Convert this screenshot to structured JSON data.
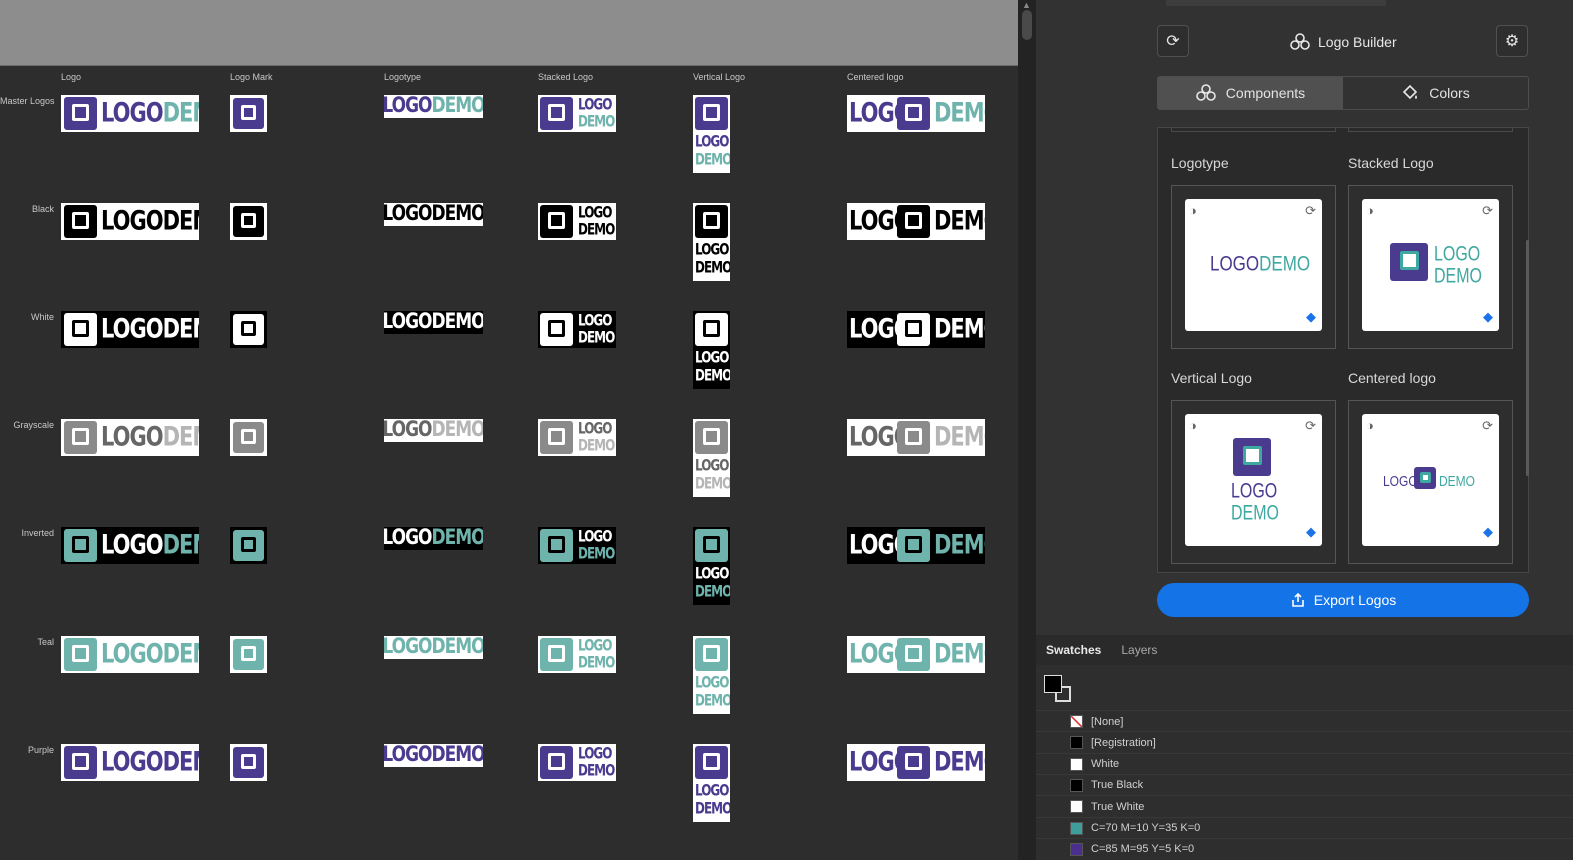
{
  "canvas": {
    "columns": [
      "Logo",
      "Logo Mark",
      "Logotype",
      "Stacked Logo",
      "Vertical Logo",
      "Centered logo"
    ],
    "rows": [
      {
        "label": "Master Logos",
        "bg": "#ffffff",
        "mark": "#4b3b8f",
        "markInner": "#ffffff",
        "word1": "#4b3b8f",
        "word2": "#6fb3ad"
      },
      {
        "label": "Black",
        "bg": "#ffffff",
        "mark": "#000000",
        "markInner": "#ffffff",
        "word1": "#000000",
        "word2": "#000000"
      },
      {
        "label": "White",
        "bg": "#000000",
        "mark": "#ffffff",
        "markInner": "#000000",
        "word1": "#ffffff",
        "word2": "#ffffff"
      },
      {
        "label": "Grayscale",
        "bg": "#ffffff",
        "mark": "#8a8a8a",
        "markInner": "#ffffff",
        "word1": "#666666",
        "word2": "#b5b5b5"
      },
      {
        "label": "Inverted",
        "bg": "#000000",
        "mark": "#6fb3ad",
        "markInner": "#000000",
        "word1": "#ffffff",
        "word2": "#6fb3ad"
      },
      {
        "label": "Teal",
        "bg": "#ffffff",
        "mark": "#6fb3ad",
        "markInner": "#ffffff",
        "word1": "#6fb3ad",
        "word2": "#6fb3ad"
      },
      {
        "label": "Purple",
        "bg": "#ffffff",
        "mark": "#4b3b8f",
        "markInner": "#ffffff",
        "word1": "#4b3b8f",
        "word2": "#4b3b8f"
      }
    ],
    "word1": "LOGO",
    "word2": "DEMO"
  },
  "panel": {
    "title": "Logo Builder",
    "tabs": [
      {
        "label": "Components",
        "icon": "components-icon",
        "active": true
      },
      {
        "label": "Colors",
        "icon": "paint-bucket-icon",
        "active": false
      }
    ],
    "cards": [
      {
        "label": "Logotype",
        "kind": "logotype"
      },
      {
        "label": "Stacked Logo",
        "kind": "stacked"
      },
      {
        "label": "Vertical Logo",
        "kind": "vertical"
      },
      {
        "label": "Centered logo",
        "kind": "centered"
      }
    ],
    "export_label": "Export Logos",
    "swatch_tabs": [
      "Swatches",
      "Layers"
    ],
    "swatches": [
      {
        "name": "[None]",
        "color": "none"
      },
      {
        "name": "[Registration]",
        "color": "#000000"
      },
      {
        "name": "White",
        "color": "#ffffff"
      },
      {
        "name": "True Black",
        "color": "#000000"
      },
      {
        "name": "True White",
        "color": "#ffffff"
      },
      {
        "name": "C=70 M=10 Y=35 K=0",
        "color": "#3e9f9a"
      },
      {
        "name": "C=85 M=95 Y=5 K=0",
        "color": "#4b2f8f"
      }
    ]
  },
  "colors": {
    "purple": "#4b3b8f",
    "teal": "#3fa8a0",
    "accent": "#1473e6"
  }
}
